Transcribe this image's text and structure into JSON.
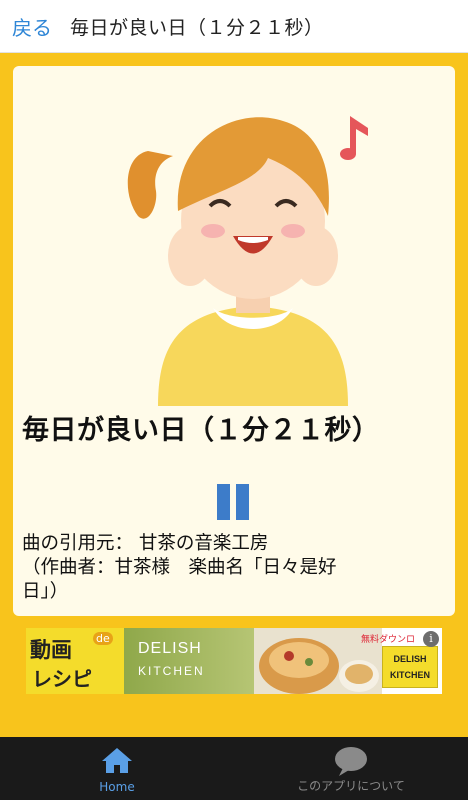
{
  "header": {
    "back_label": "戻る",
    "title": "毎日が良い日（１分２１秒）"
  },
  "player": {
    "song_title": "毎日が良い日（１分２１秒）",
    "state": "playing",
    "credit": "曲の引用元： 甘茶の音楽工房\n（作曲者：甘茶様　楽曲名「日々是好\n日」）"
  },
  "ad": {
    "main_line1": "動画",
    "de": "de",
    "main_line2": "レシピ",
    "brand_line1": "DELISH",
    "brand_line2": "KITCHEN",
    "free_download": "無料ダウンロ",
    "logo_line1": "DELISH",
    "logo_line2": "KITCHEN",
    "info": "i"
  },
  "bottom_nav": {
    "items": [
      {
        "label": "Home",
        "icon": "home-icon",
        "active": true
      },
      {
        "label": "このアプリについて",
        "icon": "speech-bubble-icon",
        "active": false
      }
    ]
  },
  "colors": {
    "background": "#f8c41c",
    "card": "#fffbe9",
    "accent": "#2f86d6",
    "pause": "#3d7cc9"
  }
}
